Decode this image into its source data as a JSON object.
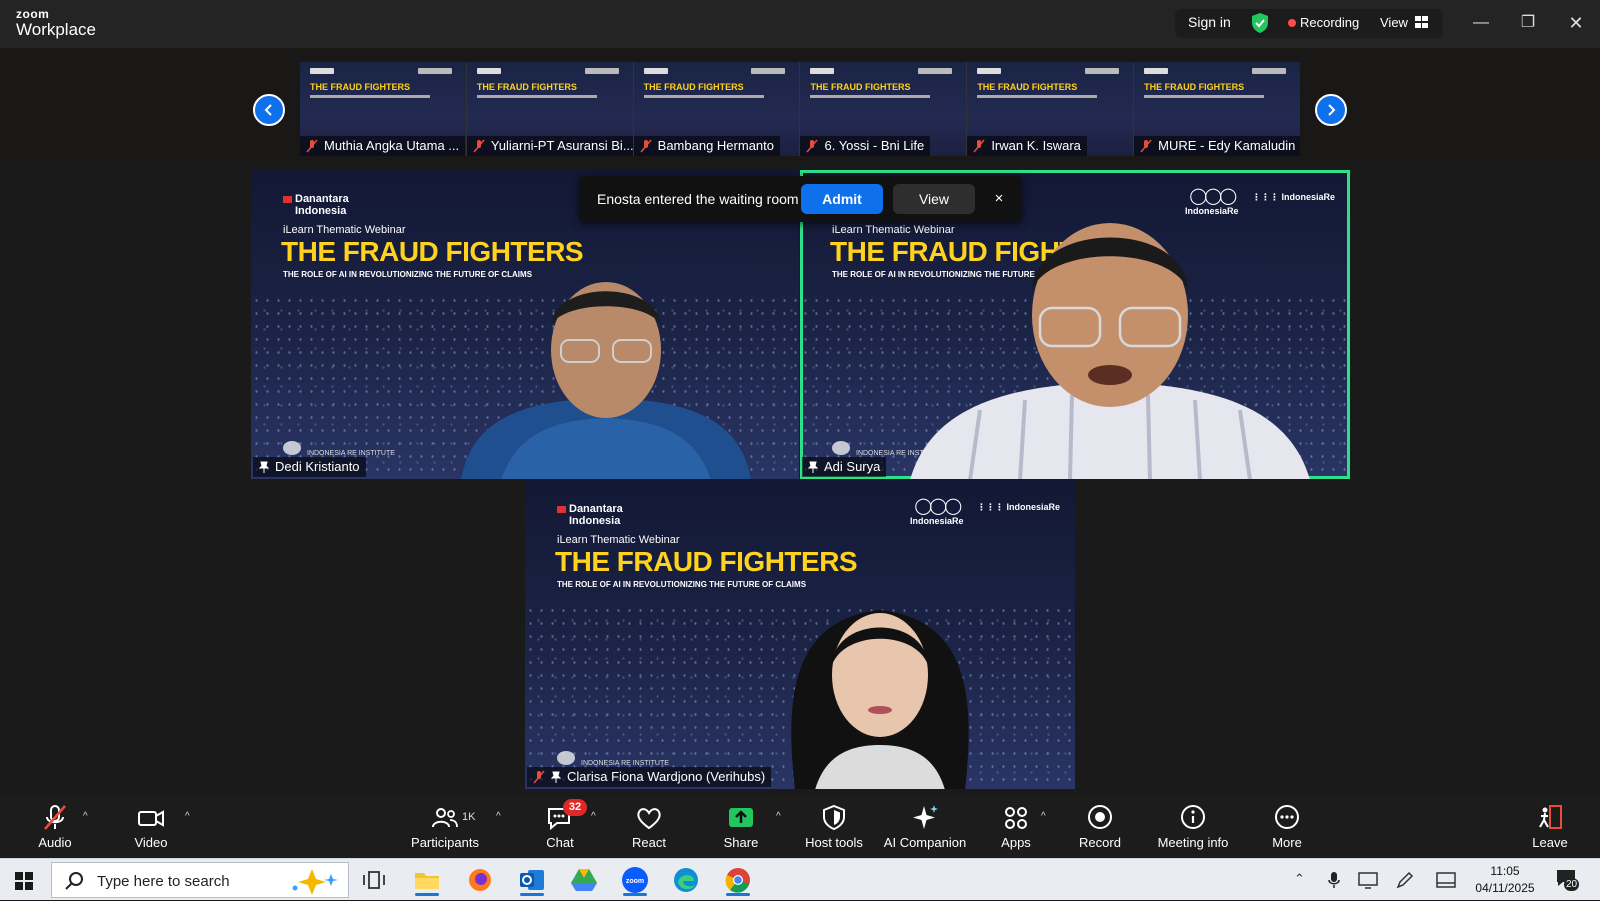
{
  "app": {
    "logo_top": "zoom",
    "logo_bottom": "Workplace",
    "sign_in": "Sign in",
    "recording": "Recording",
    "view": "View"
  },
  "filmstrip": {
    "participants": [
      {
        "name": "Muthia Angka Utama ..."
      },
      {
        "name": "Yuliarni-PT Asuransi Bi..."
      },
      {
        "name": "Bambang Hermanto"
      },
      {
        "name": "6. Yossi - Bni Life"
      },
      {
        "name": "Irwan K. Iswara"
      },
      {
        "name": "MURE - Edy Kamaludin"
      }
    ],
    "thumb_title": "THE FRAUD FIGHTERS"
  },
  "slide": {
    "brand_line1": "Danantara",
    "brand_line2": "Indonesia",
    "reinsurer": "IndonesiaRe",
    "kicker": "iLearn Thematic Webinar",
    "title": "THE FRAUD FIGHTERS",
    "tagline": "THE ROLE OF AI IN REVOLUTIONIZING THE FUTURE OF CLAIMS",
    "institute": "INDONESIA RE INSTITUTE"
  },
  "tiles": [
    {
      "name": "Dedi Kristianto"
    },
    {
      "name": "Adi Surya"
    },
    {
      "name": "Clarisa Fiona Wardjono (Verihubs)"
    }
  ],
  "notification": {
    "message": "Enosta entered the waiting room",
    "admit": "Admit",
    "view": "View",
    "close": "×"
  },
  "toolbar": {
    "audio": "Audio",
    "video": "Video",
    "participants": "Participants",
    "participants_count": "1K",
    "chat": "Chat",
    "chat_badge": "32",
    "react": "React",
    "share": "Share",
    "host_tools": "Host tools",
    "ai_companion": "AI Companion",
    "apps": "Apps",
    "record": "Record",
    "meeting_info": "Meeting info",
    "more": "More",
    "leave": "Leave"
  },
  "taskbar": {
    "search_placeholder": "Type here to search",
    "time": "11:05",
    "date": "04/11/2025",
    "notifications": "20"
  },
  "colors": {
    "accent": "#0e71eb",
    "active_speaker": "#2fe08a",
    "recording": "#ff4d4d",
    "slide_title": "#ffd21f"
  }
}
